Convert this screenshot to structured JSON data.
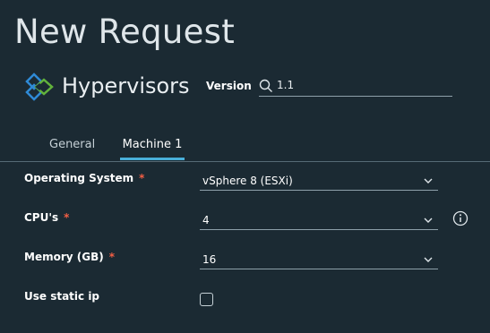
{
  "page": {
    "title": "New Request"
  },
  "catalog": {
    "name": "Hypervisors",
    "version_label": "Version",
    "version_value": "1.1"
  },
  "tabs": [
    {
      "label": "General",
      "active": false
    },
    {
      "label": "Machine 1",
      "active": true
    }
  ],
  "form": {
    "operating_system": {
      "label": "Operating System",
      "required_mark": "*",
      "value": "vSphere 8 (ESXi)"
    },
    "cpus": {
      "label": "CPU's",
      "required_mark": "*",
      "value": "4"
    },
    "memory": {
      "label": "Memory (GB)",
      "required_mark": "*",
      "value": "16"
    },
    "static_ip": {
      "label": "Use static ip",
      "checked": false
    }
  },
  "icons": {
    "logo": "hypervisor-logo-icon",
    "search": "search-icon",
    "dropdown": "chevron-down-icon",
    "info": "info-icon"
  },
  "colors": {
    "background": "#1b2a33",
    "accent": "#49afd9",
    "required": "#f35e44",
    "logo_blue": "#2f8ad6",
    "logo_green": "#62b33c"
  }
}
